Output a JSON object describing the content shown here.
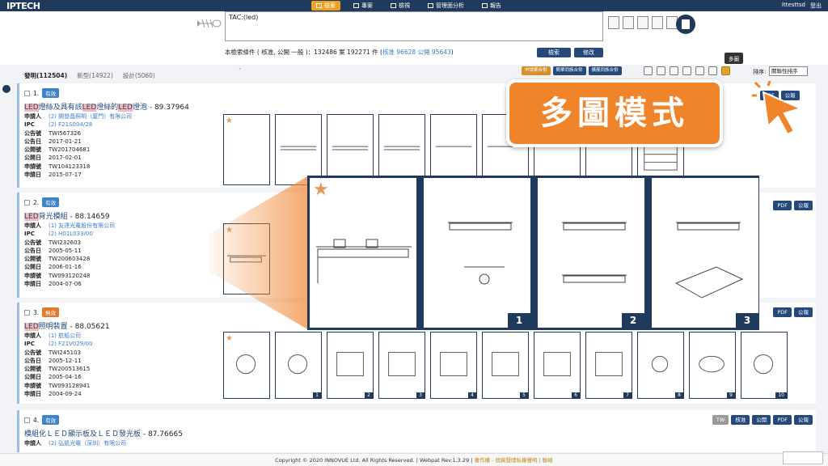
{
  "topbar": {
    "logo": "IPTECH",
    "nav": [
      {
        "label": "檢索",
        "active": true
      },
      {
        "label": "專案",
        "active": false
      },
      {
        "label": "檢視",
        "active": false
      },
      {
        "label": "管理面分析",
        "active": false
      },
      {
        "label": "報告",
        "active": false
      }
    ],
    "user": "Ittesttsd",
    "logout": "登出"
  },
  "search": {
    "query": "TAC:(led)",
    "cond_prefix": "本檢索條件 ( 核准, 公開 一般 )：132486 案  192271 件 (",
    "cond_link": "核准 96628 公開 95643",
    "cond_suffix": ")",
    "search_btn": "檢索",
    "edit_btn": "修改"
  },
  "tabs": [
    {
      "label": "發明(112504)",
      "active": true
    },
    {
      "label": "新型(14922)",
      "active": false
    },
    {
      "label": "設計(5060)",
      "active": false
    }
  ],
  "caret": "ˇ",
  "actions": {
    "btn1": "申請案合併",
    "btn2": "簡單同族合併",
    "btn3": "擴展同族合併",
    "tooltip": "多圖",
    "sort_label": "排序:",
    "sort_value": "關聯性排序"
  },
  "callout": "多圖模式",
  "results": [
    {
      "index": "1.",
      "status": "有效",
      "title_parts": [
        {
          "t": "LED",
          "hl": true
        },
        {
          "t": "燈絲及具有該",
          "hl": false
        },
        {
          "t": "LED",
          "hl": true
        },
        {
          "t": "燈絲的",
          "hl": false
        },
        {
          "t": "LED",
          "hl": true
        },
        {
          "t": "燈泡",
          "hl": false
        }
      ],
      "score": " - 89.37964",
      "meta": [
        [
          "申請人",
          "(2) 開發晶照明（廈門）有限公司"
        ],
        [
          "IPC",
          "(2) F21S004/28"
        ],
        [
          "公告號",
          "TWI567326"
        ],
        [
          "公告日",
          "2017-01-21"
        ],
        [
          "公開號",
          "TW201704681"
        ],
        [
          "公開日",
          "2017-02-01"
        ],
        [
          "申請號",
          "TW104123318"
        ],
        [
          "申請日",
          "2015-07-17"
        ]
      ],
      "thumb_nums": [
        "",
        "",
        "",
        "",
        "",
        "",
        "",
        "",
        "",
        ""
      ],
      "pdf": "PDF",
      "gb": "公報"
    },
    {
      "index": "2.",
      "status": "有效",
      "title_parts": [
        {
          "t": "LED",
          "hl": true
        },
        {
          "t": "背光模組",
          "hl": false
        }
      ],
      "score": " - 88.14659",
      "meta": [
        [
          "申請人",
          "(1) 友達光電股份有限公司"
        ],
        [
          "IPC",
          "(2) H01L033/00"
        ],
        [
          "公告號",
          "TWI232603"
        ],
        [
          "公告日",
          "2005-05-11"
        ],
        [
          "公開號",
          "TW200603428"
        ],
        [
          "公開日",
          "2006-01-16"
        ],
        [
          "申請號",
          "TW093120248"
        ],
        [
          "申請日",
          "2004-07-06"
        ]
      ],
      "pdf": "PDF",
      "gb": "公報"
    },
    {
      "index": "3.",
      "status": "無效",
      "title_parts": [
        {
          "t": "LED",
          "hl": true
        },
        {
          "t": "照明裝置",
          "hl": false
        }
      ],
      "score": " - 88.05621",
      "meta": [
        [
          "申請人",
          "(1) 航船公司"
        ],
        [
          "IPC",
          "(2) F21V029/00"
        ],
        [
          "公告號",
          "TWI245103"
        ],
        [
          "公告日",
          "2005-12-11"
        ],
        [
          "公開號",
          "TW200513615"
        ],
        [
          "公開日",
          "2005-04-16"
        ],
        [
          "申請號",
          "TW093128941"
        ],
        [
          "申請日",
          "2004-09-24"
        ]
      ],
      "thumb_nums": [
        "1",
        "2",
        "3",
        "4",
        "5",
        "6",
        "7",
        "8",
        "9",
        "10"
      ],
      "pdf": "PDF",
      "gb": "公報"
    },
    {
      "index": "4.",
      "status": "有效",
      "title_parts": [
        {
          "t": "模組化ＬＥＤ顯示板及ＬＥＤ發光板",
          "hl": false
        }
      ],
      "score": " - 87.76665",
      "meta": [
        [
          "申請人",
          "(2) 弘凱光電（深圳）有限公司"
        ]
      ],
      "pdf": "PDF",
      "gb": "公報",
      "tw": "TW",
      "hd": "核准",
      "gk": "公開"
    }
  ],
  "zoom_nums": [
    "1",
    "2",
    "3"
  ],
  "footer": {
    "text": "Copyright © 2020 INNOVUE Ltd. All Rights Reserved. | Webpat Rev.1.3.29 |",
    "links": "著作權 - 個資暨隱私權聲明 | 聯絡"
  }
}
